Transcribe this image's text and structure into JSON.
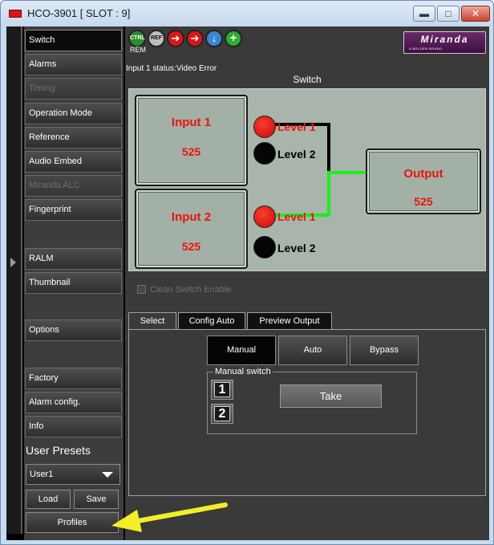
{
  "window": {
    "title": "HCO-3901 [ SLOT : 9]",
    "minimize_glyph": "▬",
    "maximize_glyph": "□",
    "close_glyph": "✕"
  },
  "sidebar": {
    "items": [
      {
        "label": "Switch",
        "state": "active"
      },
      {
        "label": "Alarms",
        "state": "normal"
      },
      {
        "label": "Timing",
        "state": "disabled"
      },
      {
        "label": "Operation Mode",
        "state": "normal"
      },
      {
        "label": "Reference",
        "state": "normal"
      },
      {
        "label": "Audio Embed",
        "state": "normal"
      },
      {
        "label": "Miranda ALC",
        "state": "disabled"
      },
      {
        "label": "Fingerprint",
        "state": "normal"
      },
      {
        "label": "RALM",
        "state": "normal"
      },
      {
        "label": "Thumbnail",
        "state": "normal"
      },
      {
        "label": "Options",
        "state": "normal"
      },
      {
        "label": "Factory",
        "state": "normal"
      },
      {
        "label": "Alarm config.",
        "state": "normal"
      },
      {
        "label": "Info",
        "state": "normal"
      }
    ],
    "user_presets_label": "User Presets",
    "preset_selected": "User1",
    "load_label": "Load",
    "save_label": "Save",
    "profiles_label": "Profiles"
  },
  "header": {
    "icons": [
      {
        "name": "ctrl-icon",
        "text": "CTRL",
        "color": "#2e8b2e"
      },
      {
        "name": "ref-icon",
        "text": "REF",
        "color": "#b0b0b0"
      },
      {
        "name": "input-arrow-icon",
        "text": "➔",
        "color": "#d9161a"
      },
      {
        "name": "output-arrow-icon",
        "text": "➔",
        "color": "#d9161a"
      },
      {
        "name": "download-icon",
        "text": "↓",
        "color": "#3a86d0"
      },
      {
        "name": "add-icon",
        "text": "+",
        "color": "#2eae2e"
      }
    ],
    "rem_label": "REM",
    "logo_text": "Miranda",
    "logo_sub": "A BELDEN BRAND"
  },
  "status": "Input 1 status:Video Error",
  "section_title": "Switch",
  "diagram": {
    "input1": {
      "name": "Input 1",
      "format": "525"
    },
    "input2": {
      "name": "Input 2",
      "format": "525"
    },
    "output": {
      "name": "Output",
      "format": "525"
    },
    "levels": [
      {
        "label": "Level 1",
        "color": "#e8140c",
        "led": "red"
      },
      {
        "label": "Level 2",
        "color": "#000000",
        "led": "black"
      },
      {
        "label": "Level 1",
        "color": "#e8140c",
        "led": "red"
      },
      {
        "label": "Level 2",
        "color": "#000000",
        "led": "black"
      }
    ],
    "active_path_color": "#18f018"
  },
  "clean_switch_label": "Clean Switch Enable",
  "tabs": [
    {
      "label": "Select",
      "active": true
    },
    {
      "label": "Config Auto",
      "active": false
    },
    {
      "label": "Preview Output",
      "active": false
    }
  ],
  "modes": [
    {
      "label": "Manual",
      "active": true
    },
    {
      "label": "Auto",
      "active": false
    },
    {
      "label": "Bypass",
      "active": false
    }
  ],
  "manual_switch": {
    "title": "Manual switch",
    "btn1": "1",
    "btn2": "2",
    "take_label": "Take"
  },
  "colors": {
    "accent_red": "#e8140c",
    "path_green": "#18f018",
    "annotation_arrow": "#f2ef2a"
  }
}
